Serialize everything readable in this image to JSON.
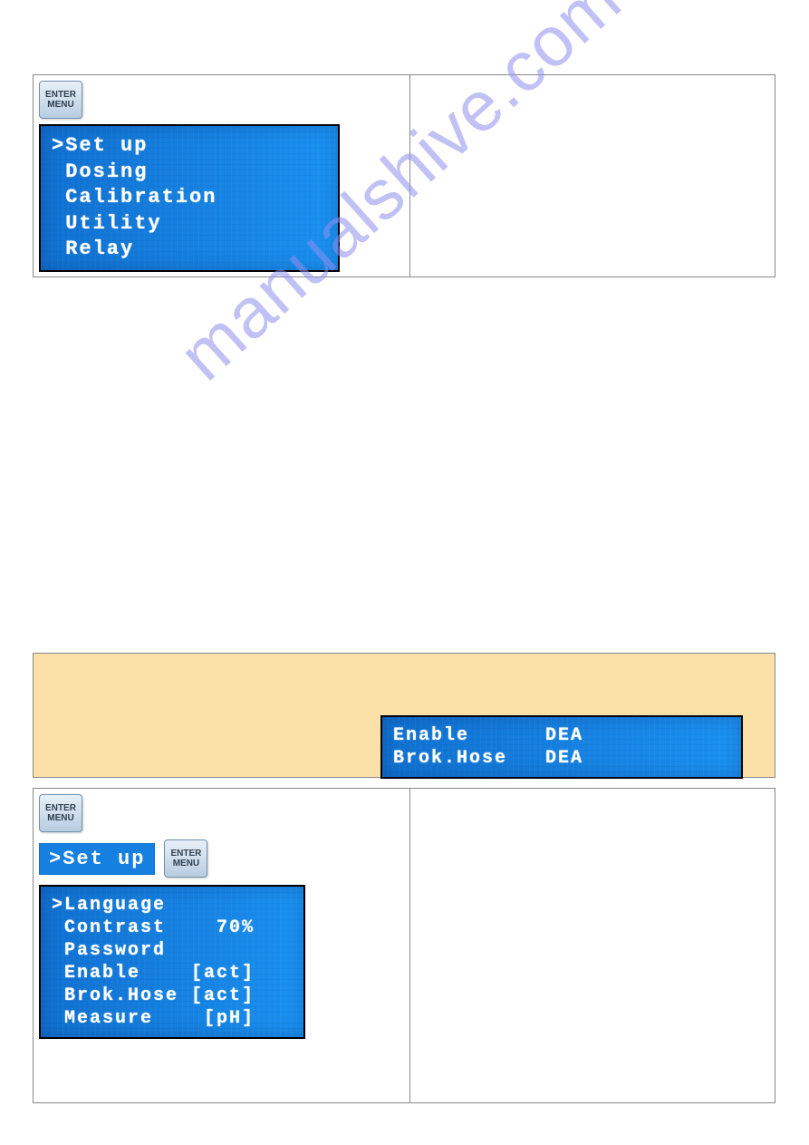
{
  "enter_menu_btn": {
    "line1": "ENTER",
    "line2": "MENU"
  },
  "top_panel": {
    "lcd_lines": [
      ">Set up",
      " Dosing",
      " Calibration",
      " Utility",
      " Relay"
    ]
  },
  "watermark": "manualshive.com",
  "yellow_banner": {
    "lcd_lines": [
      "Enable      DEA",
      "Brok.Hose   DEA"
    ]
  },
  "bottom_panel": {
    "inline_text": ">Set up",
    "lcd_lines": [
      ">Language",
      " Contrast    70%",
      " Password",
      " Enable    [act]",
      " Brok.Hose [act]",
      " Measure    [pH]"
    ]
  }
}
